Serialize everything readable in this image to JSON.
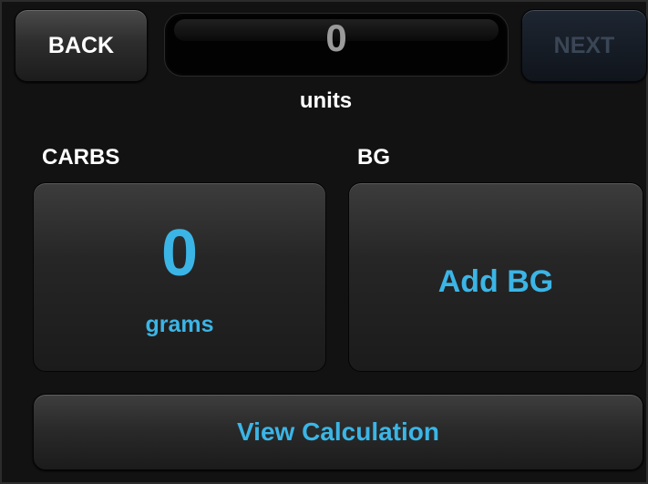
{
  "header": {
    "back_label": "BACK",
    "next_label": "NEXT",
    "units_value": "0",
    "units_label": "units"
  },
  "carbs": {
    "section_label": "CARBS",
    "value": "0",
    "unit": "grams"
  },
  "bg": {
    "section_label": "BG",
    "add_label": "Add BG"
  },
  "footer": {
    "view_calculation_label": "View Calculation"
  },
  "colors": {
    "accent": "#3bb5e6",
    "background": "#121212",
    "disabled_text": "#3a4656"
  }
}
